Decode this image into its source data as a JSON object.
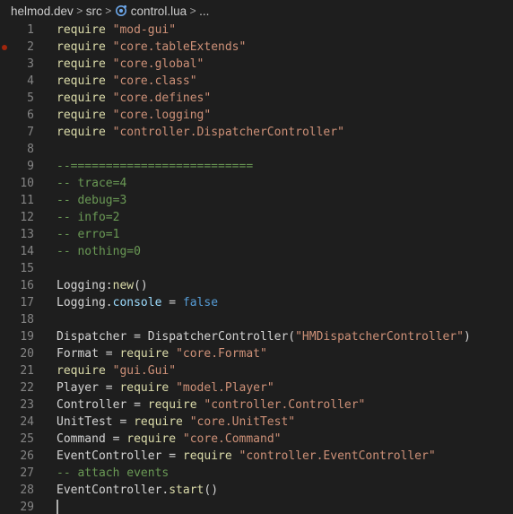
{
  "colors": {
    "background": "#1e1e1e",
    "line_number": "#858585",
    "keyword_fn": "#dcdcaa",
    "string": "#ce9178",
    "comment": "#6a9955",
    "property": "#9cdcfe",
    "boolean": "#569cd6",
    "breakpoint": "#a1260d"
  },
  "breadcrumb": {
    "items": [
      "helmod.dev",
      "src",
      "control.lua",
      "..."
    ],
    "separator": ">",
    "file_icon": "lua-file-icon"
  },
  "editor": {
    "breakpoint_line": 2,
    "cursor_line": 29,
    "lines": [
      {
        "n": "1",
        "tokens": [
          {
            "t": "require",
            "c": "kw"
          },
          {
            "t": " ",
            "c": "plain"
          },
          {
            "t": "\"mod-gui\"",
            "c": "str"
          }
        ]
      },
      {
        "n": "2",
        "tokens": [
          {
            "t": "require",
            "c": "kw"
          },
          {
            "t": " ",
            "c": "plain"
          },
          {
            "t": "\"core.tableExtends\"",
            "c": "str"
          }
        ]
      },
      {
        "n": "3",
        "tokens": [
          {
            "t": "require",
            "c": "kw"
          },
          {
            "t": " ",
            "c": "plain"
          },
          {
            "t": "\"core.global\"",
            "c": "str"
          }
        ]
      },
      {
        "n": "4",
        "tokens": [
          {
            "t": "require",
            "c": "kw"
          },
          {
            "t": " ",
            "c": "plain"
          },
          {
            "t": "\"core.class\"",
            "c": "str"
          }
        ]
      },
      {
        "n": "5",
        "tokens": [
          {
            "t": "require",
            "c": "kw"
          },
          {
            "t": " ",
            "c": "plain"
          },
          {
            "t": "\"core.defines\"",
            "c": "str"
          }
        ]
      },
      {
        "n": "6",
        "tokens": [
          {
            "t": "require",
            "c": "kw"
          },
          {
            "t": " ",
            "c": "plain"
          },
          {
            "t": "\"core.logging\"",
            "c": "str"
          }
        ]
      },
      {
        "n": "7",
        "tokens": [
          {
            "t": "require",
            "c": "kw"
          },
          {
            "t": " ",
            "c": "plain"
          },
          {
            "t": "\"controller.DispatcherController\"",
            "c": "str"
          }
        ]
      },
      {
        "n": "8",
        "tokens": []
      },
      {
        "n": "9",
        "tokens": [
          {
            "t": "--==========================",
            "c": "cmt"
          }
        ]
      },
      {
        "n": "10",
        "tokens": [
          {
            "t": "-- trace=4",
            "c": "cmt"
          }
        ]
      },
      {
        "n": "11",
        "tokens": [
          {
            "t": "-- debug=3",
            "c": "cmt"
          }
        ]
      },
      {
        "n": "12",
        "tokens": [
          {
            "t": "-- info=2",
            "c": "cmt"
          }
        ]
      },
      {
        "n": "13",
        "tokens": [
          {
            "t": "-- erro=1",
            "c": "cmt"
          }
        ]
      },
      {
        "n": "14",
        "tokens": [
          {
            "t": "-- nothing=0",
            "c": "cmt"
          }
        ]
      },
      {
        "n": "15",
        "tokens": []
      },
      {
        "n": "16",
        "tokens": [
          {
            "t": "Logging:",
            "c": "plain"
          },
          {
            "t": "new",
            "c": "fn"
          },
          {
            "t": "()",
            "c": "plain"
          }
        ]
      },
      {
        "n": "17",
        "tokens": [
          {
            "t": "Logging.",
            "c": "plain"
          },
          {
            "t": "console",
            "c": "prop"
          },
          {
            "t": " = ",
            "c": "plain"
          },
          {
            "t": "false",
            "c": "bool"
          }
        ]
      },
      {
        "n": "18",
        "tokens": []
      },
      {
        "n": "19",
        "tokens": [
          {
            "t": "Dispatcher = DispatcherController(",
            "c": "plain"
          },
          {
            "t": "\"HMDispatcherController\"",
            "c": "str"
          },
          {
            "t": ")",
            "c": "plain"
          }
        ]
      },
      {
        "n": "20",
        "tokens": [
          {
            "t": "Format = ",
            "c": "plain"
          },
          {
            "t": "require",
            "c": "kw"
          },
          {
            "t": " ",
            "c": "plain"
          },
          {
            "t": "\"core.Format\"",
            "c": "str"
          }
        ]
      },
      {
        "n": "21",
        "tokens": [
          {
            "t": "require",
            "c": "kw"
          },
          {
            "t": " ",
            "c": "plain"
          },
          {
            "t": "\"gui.Gui\"",
            "c": "str"
          }
        ]
      },
      {
        "n": "22",
        "tokens": [
          {
            "t": "Player = ",
            "c": "plain"
          },
          {
            "t": "require",
            "c": "kw"
          },
          {
            "t": " ",
            "c": "plain"
          },
          {
            "t": "\"model.Player\"",
            "c": "str"
          }
        ]
      },
      {
        "n": "23",
        "tokens": [
          {
            "t": "Controller = ",
            "c": "plain"
          },
          {
            "t": "require",
            "c": "kw"
          },
          {
            "t": " ",
            "c": "plain"
          },
          {
            "t": "\"controller.Controller\"",
            "c": "str"
          }
        ]
      },
      {
        "n": "24",
        "tokens": [
          {
            "t": "UnitTest = ",
            "c": "plain"
          },
          {
            "t": "require",
            "c": "kw"
          },
          {
            "t": " ",
            "c": "plain"
          },
          {
            "t": "\"core.UnitTest\"",
            "c": "str"
          }
        ]
      },
      {
        "n": "25",
        "tokens": [
          {
            "t": "Command = ",
            "c": "plain"
          },
          {
            "t": "require",
            "c": "kw"
          },
          {
            "t": " ",
            "c": "plain"
          },
          {
            "t": "\"core.Command\"",
            "c": "str"
          }
        ]
      },
      {
        "n": "26",
        "tokens": [
          {
            "t": "EventController = ",
            "c": "plain"
          },
          {
            "t": "require",
            "c": "kw"
          },
          {
            "t": " ",
            "c": "plain"
          },
          {
            "t": "\"controller.EventController\"",
            "c": "str"
          }
        ]
      },
      {
        "n": "27",
        "tokens": [
          {
            "t": "-- attach events",
            "c": "cmt"
          }
        ]
      },
      {
        "n": "28",
        "tokens": [
          {
            "t": "EventController.",
            "c": "plain"
          },
          {
            "t": "start",
            "c": "fn"
          },
          {
            "t": "()",
            "c": "plain"
          }
        ]
      },
      {
        "n": "29",
        "tokens": []
      }
    ]
  }
}
